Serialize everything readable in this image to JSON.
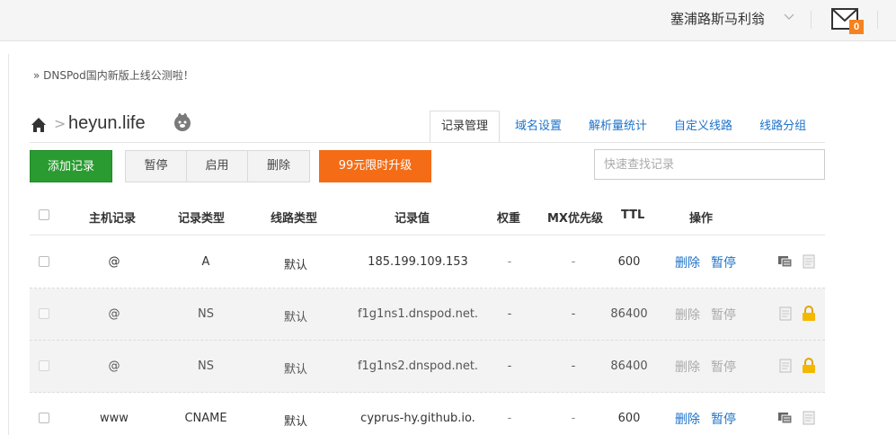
{
  "header": {
    "username": "塞浦路斯马利翁",
    "unread_count": "0"
  },
  "notice": "» DNSPod国内新版上线公测啦！",
  "domain": {
    "name": "heyun.life"
  },
  "tabs": [
    {
      "label": "记录管理",
      "active": true
    },
    {
      "label": "域名设置",
      "active": false
    },
    {
      "label": "解析量统计",
      "active": false
    },
    {
      "label": "自定义线路",
      "active": false
    },
    {
      "label": "线路分组",
      "active": false
    }
  ],
  "toolbar": {
    "add_label": "添加记录",
    "pause_label": "暂停",
    "enable_label": "启用",
    "delete_label": "删除",
    "upgrade_label": "99元限时升级",
    "search_placeholder": "快速查找记录"
  },
  "table": {
    "headers": {
      "host": "主机记录",
      "type": "记录类型",
      "line": "线路类型",
      "value": "记录值",
      "weight": "权重",
      "mx": "MX优先级",
      "ttl": "TTL",
      "ops": "操作"
    },
    "rows": [
      {
        "host": "@",
        "type": "A",
        "line": "默认",
        "value": "185.199.109.153",
        "weight": "-",
        "mx": "-",
        "ttl": "600",
        "delete": "删除",
        "pause": "暂停",
        "locked": false
      },
      {
        "host": "@",
        "type": "NS",
        "line": "默认",
        "value": "f1g1ns1.dnspod.net.",
        "weight": "-",
        "mx": "-",
        "ttl": "86400",
        "delete": "删除",
        "pause": "暂停",
        "locked": true
      },
      {
        "host": "@",
        "type": "NS",
        "line": "默认",
        "value": "f1g1ns2.dnspod.net.",
        "weight": "-",
        "mx": "-",
        "ttl": "86400",
        "delete": "删除",
        "pause": "暂停",
        "locked": true
      },
      {
        "host": "www",
        "type": "CNAME",
        "line": "默认",
        "value": "cyprus-hy.github.io.",
        "weight": "-",
        "mx": "-",
        "ttl": "600",
        "delete": "删除",
        "pause": "暂停",
        "locked": false
      }
    ]
  },
  "colors": {
    "accent_blue": "#1e73c9",
    "add_green": "#2a9b30",
    "upgrade_orange": "#f46c16",
    "lock_yellow": "#f5b800"
  },
  "icons": {
    "home": "home-icon",
    "rabbit": "rabbit-icon",
    "mail": "mail-icon",
    "remark": "remark-icon",
    "note": "note-icon",
    "lock": "lock-icon"
  }
}
